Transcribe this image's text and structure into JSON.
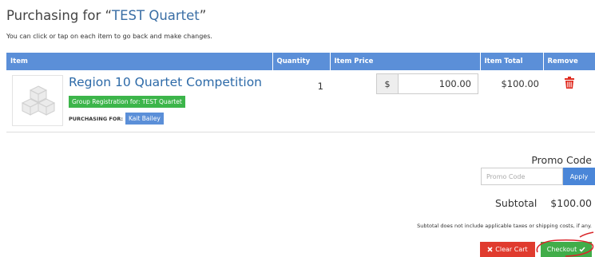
{
  "header": {
    "title_prefix": "Purchasing for “",
    "title_name": "TEST Quartet",
    "title_suffix": "”",
    "intro": "You can click or tap on each item to go back and make changes."
  },
  "table": {
    "columns": [
      "Item",
      "Quantity",
      "Item Price",
      "Item Total",
      "Remove"
    ],
    "rows": [
      {
        "name": "Region 10 Quartet Competition",
        "group_label": "Group Registration for: TEST Quartet",
        "purchasing_label": "PURCHASING FOR:",
        "purchasing_name": "Kait Bailey",
        "quantity": "1",
        "currency_symbol": "$",
        "price": "100.00",
        "total": "$100.00",
        "thumbnail_icon": "cubes-icon",
        "remove_icon": "trash-icon"
      }
    ]
  },
  "promo": {
    "title": "Promo Code",
    "placeholder": "Promo Code",
    "apply_label": "Apply"
  },
  "summary": {
    "subtotal_label": "Subtotal",
    "subtotal_value": "$100.00",
    "note": "Subtotal does not include applicable taxes or shipping costs, if any."
  },
  "actions": {
    "clear_label": "Clear Cart",
    "checkout_label": "Checkout"
  },
  "colors": {
    "header_blue": "#5b8fd8",
    "link_blue": "#2d6aa8",
    "badge_green": "#3cb54a",
    "danger_red": "#e03b2e",
    "success_green": "#41ad49",
    "annotation_red": "#d9262a"
  }
}
